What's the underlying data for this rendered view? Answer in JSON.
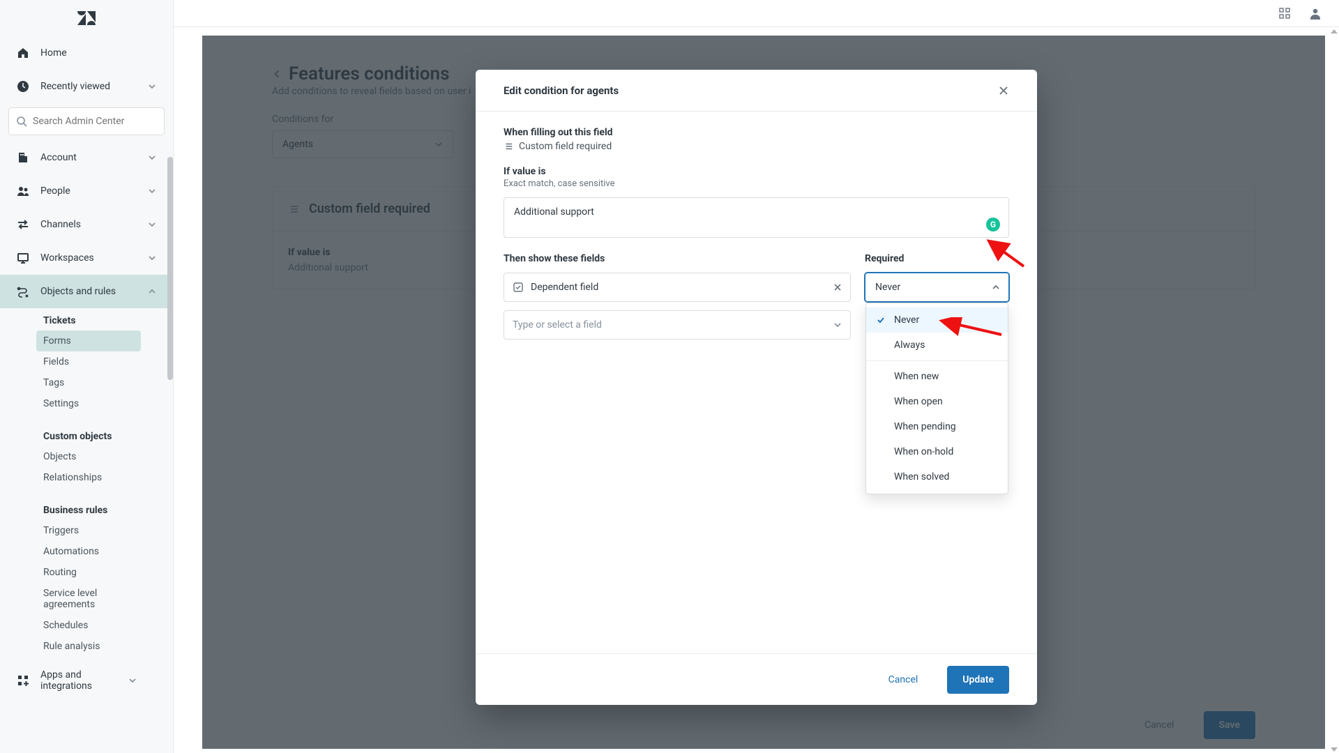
{
  "topbar": {
    "apps_icon": "apps",
    "user_icon": "user"
  },
  "sidebar": {
    "home": "Home",
    "recently_viewed": "Recently viewed",
    "search_placeholder": "Search Admin Center",
    "nav": [
      {
        "label": "Account"
      },
      {
        "label": "People"
      },
      {
        "label": "Channels"
      },
      {
        "label": "Workspaces"
      },
      {
        "label": "Objects and rules"
      }
    ],
    "tickets_head": "Tickets",
    "tickets": [
      "Forms",
      "Fields",
      "Tags",
      "Settings"
    ],
    "custom_head": "Custom objects",
    "custom": [
      "Objects",
      "Relationships"
    ],
    "biz_head": "Business rules",
    "biz": [
      "Triggers",
      "Automations",
      "Routing",
      "Service level agreements",
      "Schedules",
      "Rule analysis"
    ],
    "apps_label": "Apps and integrations"
  },
  "main": {
    "title": "Features conditions",
    "subtitle": "Add conditions to reveal fields based on user i",
    "cond_for_label": "Conditions for",
    "cond_for_value": "Agents",
    "card_title": "Custom field required",
    "if_value_label": "If value is",
    "if_value_value": "Additional support",
    "footer_cancel": "Cancel",
    "footer_save": "Save"
  },
  "modal": {
    "title": "Edit condition for agents",
    "when_label": "When filling out this field",
    "when_value": "Custom field required",
    "if_value_label": "If value is",
    "if_value_note": "Exact match, case sensitive",
    "if_value_input": "Additional support",
    "then_show_label": "Then show these fields",
    "required_label": "Required",
    "chip_value": "Dependent field",
    "type_placeholder": "Type or select a field",
    "required_value": "Never",
    "dropdown_group1": [
      "Never",
      "Always"
    ],
    "dropdown_group2": [
      "When new",
      "When open",
      "When pending",
      "When on-hold",
      "When solved"
    ],
    "dropdown_selected_index": 0,
    "footer_cancel": "Cancel",
    "footer_update": "Update"
  }
}
